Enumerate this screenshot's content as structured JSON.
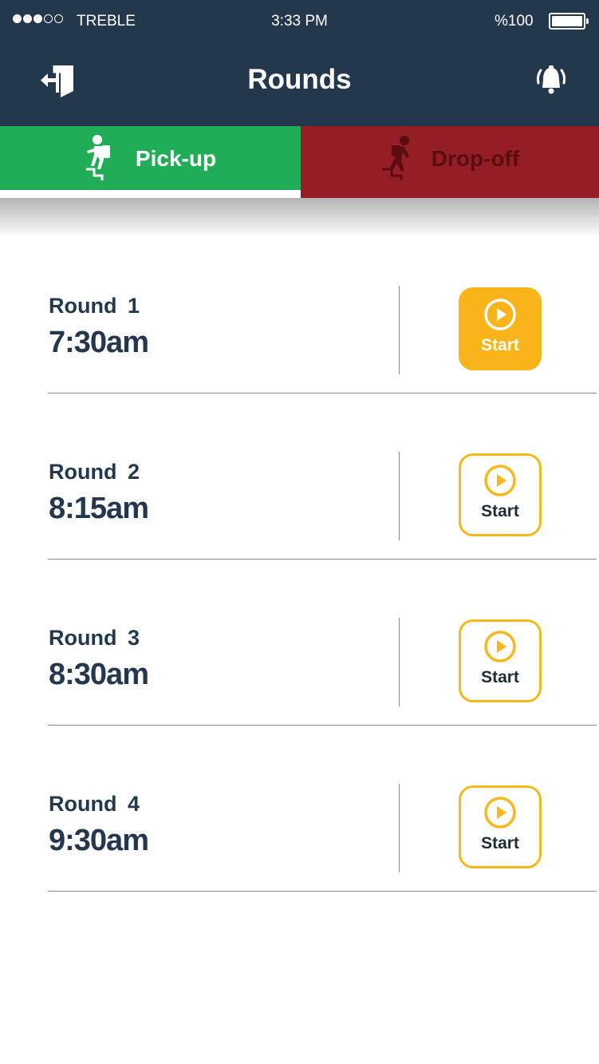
{
  "status_bar": {
    "signal_bars_filled": 3,
    "signal_bars_total": 5,
    "carrier": "TREBLE",
    "time": "3:33 PM",
    "battery_text": "%100",
    "battery_level": 1.0
  },
  "header": {
    "title": "Rounds",
    "left_icon": "logout-door-icon",
    "right_icon": "bell-ringing-icon"
  },
  "tabs": [
    {
      "label": "Pick-up",
      "icon": "person-climbing-stairs-icon",
      "selected": true,
      "color": "#21ad57"
    },
    {
      "label": "Drop-off",
      "icon": "person-descending-stairs-icon",
      "selected": false,
      "color": "#941e26"
    }
  ],
  "rounds": [
    {
      "label": "Round 1",
      "time": "7:30am",
      "button_label": "Start",
      "active": true
    },
    {
      "label": "Round 2",
      "time": "8:15am",
      "button_label": "Start",
      "active": false
    },
    {
      "label": "Round 3",
      "time": "8:30am",
      "button_label": "Start",
      "active": false
    },
    {
      "label": "Round 4",
      "time": "9:30am",
      "button_label": "Start",
      "active": false
    }
  ],
  "colors": {
    "header_bg": "#24384d",
    "accent": "#f9b419",
    "text_primary": "#24384d"
  }
}
